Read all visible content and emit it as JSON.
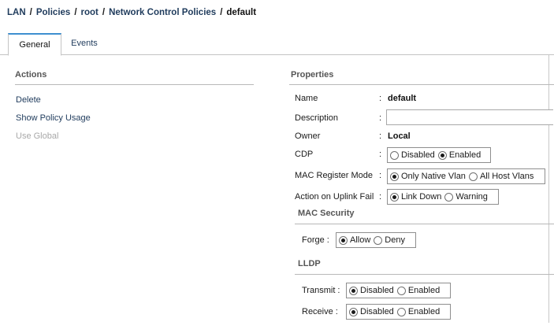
{
  "breadcrumb": {
    "items": [
      "LAN",
      "Policies",
      "root",
      "Network Control Policies"
    ],
    "separator": "/",
    "current": "default"
  },
  "tabs": [
    {
      "label": "General",
      "active": true
    },
    {
      "label": "Events",
      "active": false
    }
  ],
  "actions": {
    "heading": "Actions",
    "items": [
      {
        "label": "Delete",
        "enabled": true
      },
      {
        "label": "Show Policy Usage",
        "enabled": true
      },
      {
        "label": "Use Global",
        "enabled": false
      }
    ]
  },
  "properties": {
    "heading": "Properties",
    "colon": ":",
    "name": {
      "label": "Name",
      "value": "default"
    },
    "description": {
      "label": "Description",
      "value": ""
    },
    "owner": {
      "label": "Owner",
      "value": "Local"
    },
    "cdp": {
      "label": "CDP",
      "options": [
        "Disabled",
        "Enabled"
      ],
      "selected": "Enabled"
    },
    "mac_register_mode": {
      "label": "MAC Register Mode",
      "options": [
        "Only Native Vlan",
        "All Host Vlans"
      ],
      "selected": "Only Native Vlan"
    },
    "action_on_uplink_fail": {
      "label": "Action on Uplink Fail",
      "options": [
        "Link Down",
        "Warning"
      ],
      "selected": "Link Down"
    }
  },
  "mac_security": {
    "heading": "MAC Security",
    "forge": {
      "label": "Forge :",
      "options": [
        "Allow",
        "Deny"
      ],
      "selected": "Allow"
    }
  },
  "lldp": {
    "heading": "LLDP",
    "transmit": {
      "label": "Transmit :",
      "options": [
        "Disabled",
        "Enabled"
      ],
      "selected": "Disabled"
    },
    "receive": {
      "label": "Receive :",
      "options": [
        "Disabled",
        "Enabled"
      ],
      "selected": "Disabled"
    }
  },
  "colors": {
    "link": "#1f3b5c",
    "tab_accent": "#3e8fd0",
    "disabled_text": "#a8a8a8"
  }
}
